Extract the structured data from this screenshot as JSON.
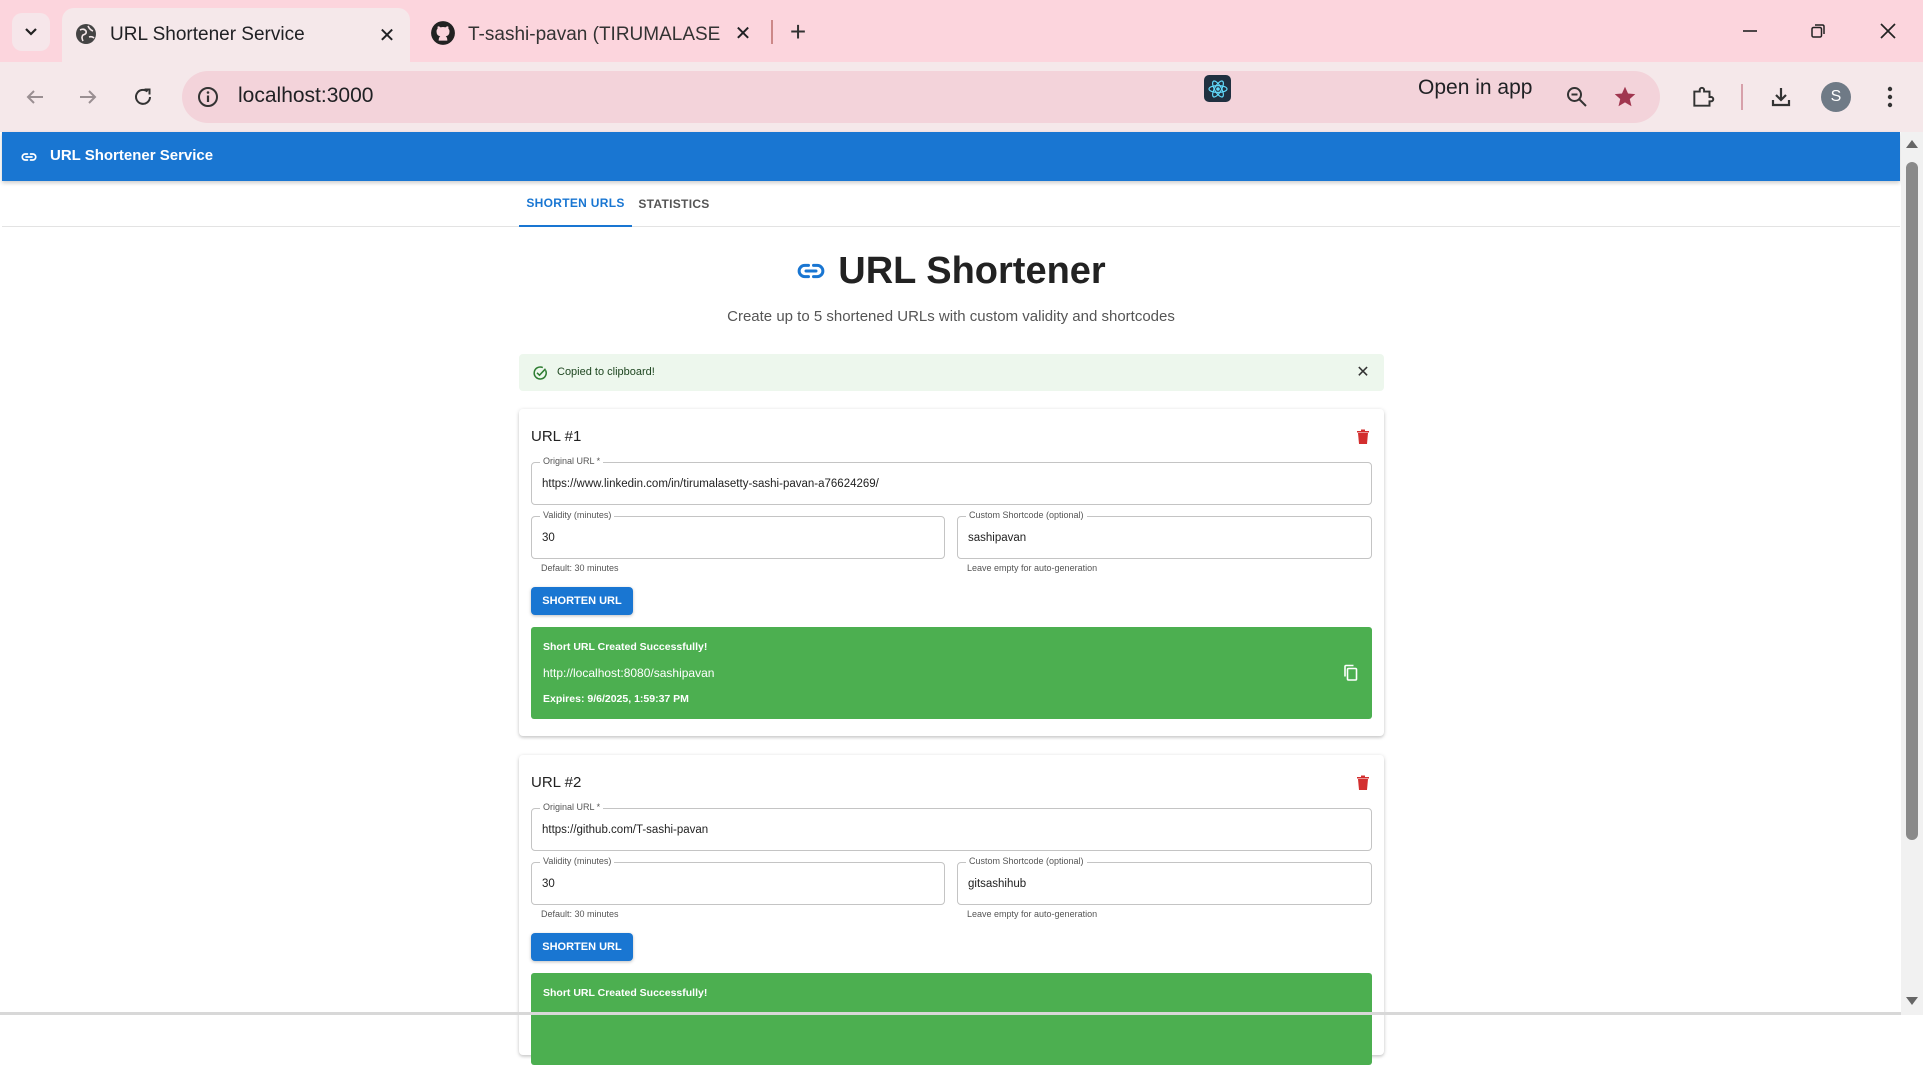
{
  "browser": {
    "tabs": [
      {
        "title": "URL Shortener Service",
        "active": true
      },
      {
        "title": "T-sashi-pavan (TIRUMALASETTY",
        "active": false
      }
    ],
    "url": "localhost:3000",
    "open_in_app": "Open in app",
    "profile_initial": "S",
    "chrome_color": "#fcd5dd"
  },
  "app": {
    "appbar_title": "URL Shortener Service",
    "tabs": [
      "SHORTEN URLS",
      "STATISTICS"
    ],
    "active_tab": "SHORTEN URLS",
    "heading": "URL Shortener",
    "subtitle": "Create up to 5 shortened URLs with custom validity and shortcodes",
    "alert": "Copied to clipboard!",
    "primary_color": "#1976d2",
    "success_color": "#4caf50",
    "delete_color": "#d32f2f"
  },
  "url_cards": [
    {
      "title": "URL #1",
      "original_url_label": "Original URL *",
      "original_url": "https://www.linkedin.com/in/tirumalasetty-sashi-pavan-a76624269/",
      "validity_label": "Validity (minutes)",
      "validity": "30",
      "validity_helper": "Default: 30 minutes",
      "shortcode_label": "Custom Shortcode (optional)",
      "shortcode": "sashipavan",
      "shortcode_helper": "Leave empty for auto-generation",
      "button": "SHORTEN URL",
      "result_title": "Short URL Created Successfully!",
      "short_url": "http://localhost:8080/sashipavan",
      "expires_label": "Expires:",
      "expires_value": "9/6/2025, 1:59:37 PM"
    },
    {
      "title": "URL #2",
      "original_url_label": "Original URL *",
      "original_url": "https://github.com/T-sashi-pavan",
      "validity_label": "Validity (minutes)",
      "validity": "30",
      "validity_helper": "Default: 30 minutes",
      "shortcode_label": "Custom Shortcode (optional)",
      "shortcode": "gitsashihub",
      "shortcode_helper": "Leave empty for auto-generation",
      "button": "SHORTEN URL",
      "result_title": "Short URL Created Successfully!"
    }
  ],
  "icons": {
    "tab_list": "chevron-down-icon",
    "favicon_1": "globe-icon",
    "favicon_2": "github-icon",
    "back": "arrow-left-icon",
    "forward": "arrow-right-icon",
    "reload": "reload-icon",
    "site_info": "info-icon",
    "zoom": "zoom-out-icon",
    "bookmark": "star-icon",
    "extensions": "puzzle-icon",
    "download": "download-icon",
    "menu": "more-vert-icon",
    "link": "link-icon",
    "success": "check-circle-icon",
    "delete": "trash-icon",
    "copy": "copy-icon"
  }
}
